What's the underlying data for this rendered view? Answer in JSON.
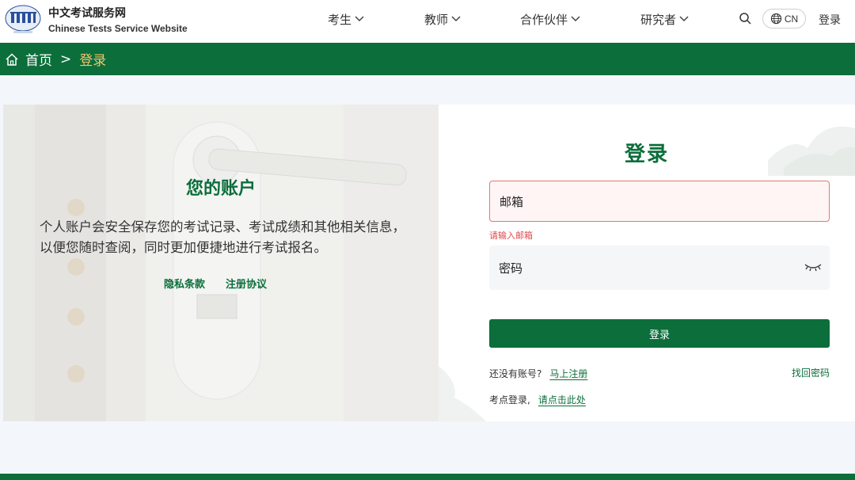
{
  "brand": {
    "name_cn": "中文考试服务网",
    "name_en": "Chinese Tests Service Website"
  },
  "nav": {
    "items": [
      {
        "label": "考生"
      },
      {
        "label": "教师"
      },
      {
        "label": "合作伙伴"
      },
      {
        "label": "研究者"
      }
    ],
    "search_icon": "search-icon",
    "language": "CN",
    "login": "登录"
  },
  "breadcrumb": {
    "home": "首页",
    "separator": ">",
    "current": "登录"
  },
  "account_panel": {
    "title": "您的账户",
    "description": "个人账户会安全保存您的考试记录、考试成绩和其他相关信息，以便您随时查阅，同时更加便捷地进行考试报名。",
    "links": [
      "隐私条款",
      "注册协议"
    ]
  },
  "login_form": {
    "title": "登录",
    "email_placeholder": "邮箱",
    "email_error": "请输入邮箱",
    "password_placeholder": "密码",
    "submit": "登录",
    "no_account_text": "还没有账号?",
    "register_link": "马上注册",
    "forgot_link": "找回密码",
    "site_login_text": "考点登录,",
    "site_login_link": "请点击此处"
  },
  "colors": {
    "brand_green": "#0b6e3b",
    "breadcrumb_current": "#f2c56a",
    "error_red": "#e0494c"
  }
}
